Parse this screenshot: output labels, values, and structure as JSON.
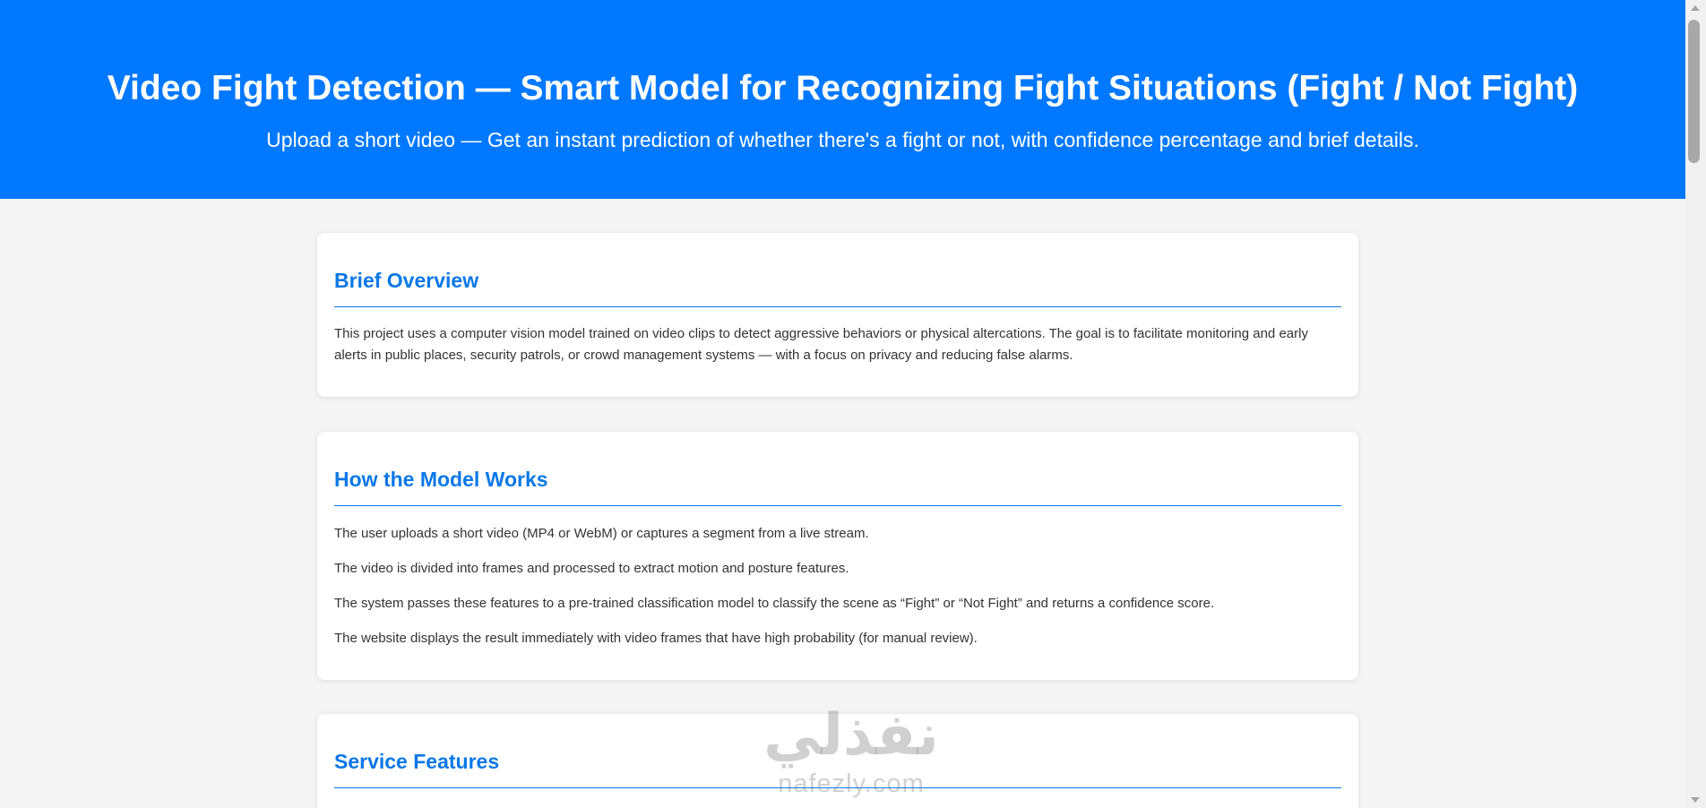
{
  "header": {
    "title": "Video Fight Detection — Smart Model for Recognizing Fight Situations (Fight / Not Fight)",
    "subtitle": "Upload a short video — Get an instant prediction of whether there's a fight or not, with confidence percentage and brief details."
  },
  "overview": {
    "heading": "Brief Overview",
    "text": "This project uses a computer vision model trained on video clips to detect aggressive behaviors or physical altercations. The goal is to facilitate monitoring and early alerts in public places, security patrols, or crowd management systems — with a focus on privacy and reducing false alarms."
  },
  "how_it_works": {
    "heading": "How the Model Works",
    "steps": [
      "The user uploads a short video (MP4 or WebM) or captures a segment from a live stream.",
      "The video is divided into frames and processed to extract motion and posture features.",
      "The system passes these features to a pre-trained classification model to classify the scene as “Fight” or “Not Fight” and returns a confidence score.",
      "The website displays the result immediately with video frames that have high probability (for manual review)."
    ]
  },
  "features": {
    "heading": "Service Features"
  },
  "watermark": {
    "arabic": "نفذلي",
    "latin": "nafezly.com"
  },
  "colors": {
    "header_bg": "#0078ff",
    "heading": "#0a78e6",
    "page_bg": "#f4f4f4"
  }
}
